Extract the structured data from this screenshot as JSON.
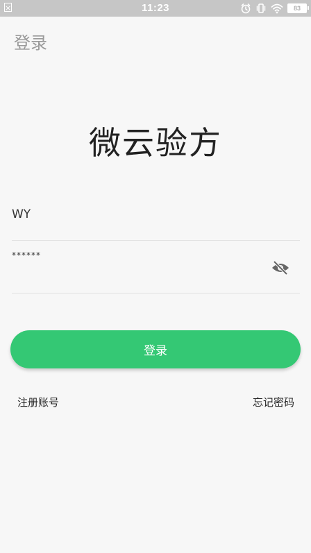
{
  "status_bar": {
    "time": "11:23",
    "battery_level": "83",
    "left_icon": "x-box-icon",
    "icons": [
      "alarm-icon",
      "vibrate-icon",
      "wifi-icon",
      "battery-icon"
    ]
  },
  "header": {
    "title": "登录"
  },
  "app": {
    "title": "微云验方"
  },
  "form": {
    "username_value": "WY",
    "password_value": "******",
    "password_toggle_icon": "eye-off-icon"
  },
  "actions": {
    "login_label": "登录",
    "register_label": "注册账号",
    "forgot_label": "忘记密码"
  },
  "colors": {
    "accent": "#34c874",
    "status_bar": "#c6c6c6",
    "background": "#f7f7f7"
  }
}
